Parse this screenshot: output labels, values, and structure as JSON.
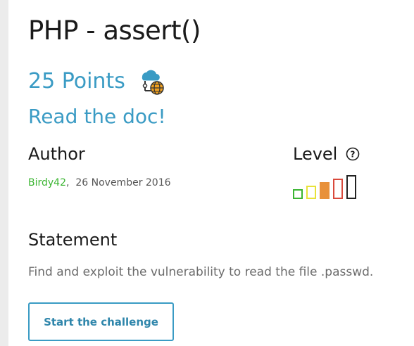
{
  "challenge": {
    "title": "PHP - assert()",
    "points": "25 Points",
    "category_icon": "cloud-network-icon",
    "subtitle": "Read the doc!"
  },
  "author": {
    "label": "Author",
    "name": "Birdy42",
    "date": "26 November 2016"
  },
  "level": {
    "label": "Level",
    "help_icon": "question-circle-icon",
    "current": 3,
    "max": 5,
    "colors": [
      "#3bb532",
      "#e8e23a",
      "#e8913a",
      "#d9493c",
      "#222222"
    ]
  },
  "statement": {
    "label": "Statement",
    "text": "Find and exploit the vulnerability to read the file .passwd."
  },
  "actions": {
    "start_label": "Start the challenge"
  },
  "colors": {
    "accent": "#3a9bc4",
    "author_link": "#3bb532"
  }
}
